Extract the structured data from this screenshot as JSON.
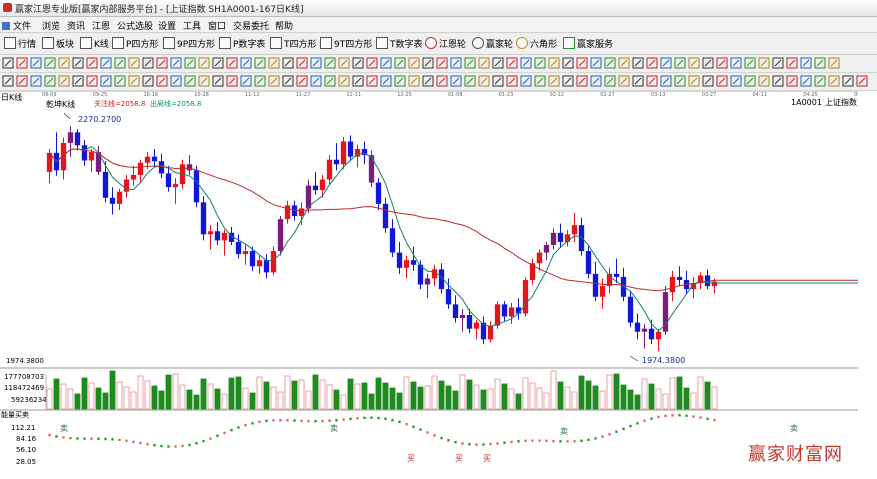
{
  "window": {
    "title": "赢家江恩专业版[赢家内部服务平台] - [上证指数  SH1A0001-167日K线]"
  },
  "menu": [
    "文件",
    "浏览",
    "资讯",
    "江恩",
    "公式选股",
    "设置",
    "工具",
    "窗口",
    "交易委托",
    "帮助"
  ],
  "toolbar": [
    "行情",
    "板块",
    "K线",
    "P四方形",
    "9P四方形",
    "P数字表",
    "T四方形",
    "9T四方形",
    "T数字表",
    "江恩轮",
    "赢家轮",
    "六角形",
    "赢家服务"
  ],
  "chart_header": {
    "period": "日K线",
    "code": "1A0001",
    "name": "上证指数",
    "indicator_name": "乾坤K线",
    "attention_line": "关注线=2058.8",
    "exit_line": "出局线=2058.8",
    "high_label": "2270.2700",
    "low_label": "1974.3800",
    "price_axis_label": "1974.3800"
  },
  "x_dates": [
    "09-09",
    "09-25",
    "10-16",
    "10-28",
    "11-12",
    "11-27",
    "12-11",
    "12-25",
    "01-08",
    "01-23",
    "02-12",
    "02-27",
    "03-13",
    "03-27",
    "04-11",
    "04-25",
    "05-09"
  ],
  "volume_panel": {
    "ticks": [
      "177708703",
      "118472469",
      "59236234"
    ]
  },
  "buysell_panel": {
    "title": "能量买卖",
    "ticks": [
      "112.21",
      "84.16",
      "56.10",
      "28.05"
    ],
    "signals": [
      "卖",
      "卖",
      "卖",
      "卖",
      "买",
      "买",
      "买"
    ]
  },
  "watermark": "赢家财富网",
  "colors": {
    "up": "#e8141b",
    "down": "#1018d8",
    "neutral": "#7a1c7e",
    "ma": "#12806a",
    "ma_long": "#c0282b",
    "vol_up": "#e78a93",
    "vol_down": "#1f8a1f"
  },
  "chart_data": {
    "type": "candlestick",
    "candles": [
      [
        2210,
        2240,
        2195,
        2235
      ],
      [
        2235,
        2262,
        2205,
        2212
      ],
      [
        2212,
        2255,
        2200,
        2248
      ],
      [
        2248,
        2270.27,
        2230,
        2262
      ],
      [
        2262,
        2266,
        2238,
        2245
      ],
      [
        2245,
        2252,
        2218,
        2225
      ],
      [
        2225,
        2240,
        2210,
        2236
      ],
      [
        2236,
        2244,
        2206,
        2210
      ],
      [
        2210,
        2224,
        2170,
        2176
      ],
      [
        2176,
        2190,
        2154,
        2168
      ],
      [
        2168,
        2188,
        2160,
        2184
      ],
      [
        2184,
        2206,
        2176,
        2200
      ],
      [
        2200,
        2218,
        2192,
        2206
      ],
      [
        2206,
        2226,
        2196,
        2222
      ],
      [
        2222,
        2236,
        2214,
        2230
      ],
      [
        2230,
        2240,
        2218,
        2224
      ],
      [
        2224,
        2234,
        2202,
        2208
      ],
      [
        2208,
        2218,
        2184,
        2190
      ],
      [
        2190,
        2202,
        2168,
        2194
      ],
      [
        2194,
        2226,
        2188,
        2220
      ],
      [
        2220,
        2232,
        2206,
        2212
      ],
      [
        2212,
        2218,
        2164,
        2170
      ],
      [
        2170,
        2178,
        2120,
        2128
      ],
      [
        2128,
        2140,
        2108,
        2132
      ],
      [
        2132,
        2144,
        2114,
        2120
      ],
      [
        2120,
        2134,
        2100,
        2130
      ],
      [
        2130,
        2138,
        2114,
        2118
      ],
      [
        2118,
        2128,
        2096,
        2102
      ],
      [
        2102,
        2116,
        2088,
        2106
      ],
      [
        2106,
        2112,
        2080,
        2086
      ],
      [
        2086,
        2100,
        2076,
        2094
      ],
      [
        2094,
        2102,
        2070,
        2078
      ],
      [
        2078,
        2112,
        2074,
        2106
      ],
      [
        2106,
        2152,
        2100,
        2148
      ],
      [
        2148,
        2172,
        2142,
        2166
      ],
      [
        2166,
        2172,
        2146,
        2152
      ],
      [
        2152,
        2170,
        2140,
        2162
      ],
      [
        2162,
        2200,
        2156,
        2192
      ],
      [
        2192,
        2210,
        2180,
        2186
      ],
      [
        2186,
        2206,
        2176,
        2200
      ],
      [
        2200,
        2232,
        2194,
        2226
      ],
      [
        2226,
        2248,
        2212,
        2220
      ],
      [
        2220,
        2256,
        2214,
        2250
      ],
      [
        2250,
        2258,
        2224,
        2230
      ],
      [
        2230,
        2246,
        2216,
        2240
      ],
      [
        2240,
        2250,
        2220,
        2232
      ],
      [
        2232,
        2238,
        2190,
        2196
      ],
      [
        2196,
        2202,
        2160,
        2168
      ],
      [
        2168,
        2176,
        2130,
        2136
      ],
      [
        2136,
        2148,
        2098,
        2104
      ],
      [
        2104,
        2118,
        2076,
        2084
      ],
      [
        2084,
        2100,
        2070,
        2094
      ],
      [
        2094,
        2112,
        2080,
        2088
      ],
      [
        2088,
        2094,
        2056,
        2062
      ],
      [
        2062,
        2076,
        2044,
        2070
      ],
      [
        2070,
        2088,
        2060,
        2082
      ],
      [
        2082,
        2090,
        2050,
        2056
      ],
      [
        2056,
        2070,
        2030,
        2036
      ],
      [
        2036,
        2048,
        2012,
        2018
      ],
      [
        2018,
        2030,
        2000,
        2022
      ],
      [
        2022,
        2030,
        1998,
        2004
      ],
      [
        2004,
        2016,
        1990,
        2012
      ],
      [
        2012,
        2020,
        1984,
        1990
      ],
      [
        1990,
        2014,
        1986,
        2008
      ],
      [
        2008,
        2040,
        2004,
        2036
      ],
      [
        2036,
        2040,
        2014,
        2020
      ],
      [
        2020,
        2038,
        2010,
        2032
      ],
      [
        2032,
        2044,
        2016,
        2024
      ],
      [
        2024,
        2072,
        2020,
        2068
      ],
      [
        2068,
        2096,
        2062,
        2090
      ],
      [
        2090,
        2108,
        2080,
        2104
      ],
      [
        2104,
        2118,
        2094,
        2114
      ],
      [
        2114,
        2136,
        2108,
        2130
      ],
      [
        2130,
        2142,
        2110,
        2118
      ],
      [
        2118,
        2134,
        2112,
        2128
      ],
      [
        2128,
        2156,
        2118,
        2140
      ],
      [
        2140,
        2150,
        2100,
        2106
      ],
      [
        2106,
        2112,
        2070,
        2076
      ],
      [
        2076,
        2092,
        2040,
        2046
      ],
      [
        2046,
        2070,
        2030,
        2060
      ],
      [
        2060,
        2084,
        2050,
        2076
      ],
      [
        2076,
        2096,
        2064,
        2072
      ],
      [
        2072,
        2084,
        2040,
        2046
      ],
      [
        2046,
        2054,
        2006,
        2012
      ],
      [
        2012,
        2024,
        1990,
        2000
      ],
      [
        2000,
        2010,
        1978,
        2004
      ],
      [
        2004,
        2016,
        1984,
        1990
      ],
      [
        1990,
        2004,
        1974.38,
        2000
      ],
      [
        2000,
        2060,
        1996,
        2052
      ],
      [
        2052,
        2080,
        2040,
        2072
      ],
      [
        2072,
        2086,
        2060,
        2068
      ],
      [
        2068,
        2080,
        2050,
        2056
      ],
      [
        2056,
        2072,
        2044,
        2064
      ],
      [
        2064,
        2078,
        2056,
        2074
      ],
      [
        2074,
        2082,
        2056,
        2060
      ],
      [
        2060,
        2070,
        2050,
        2066
      ]
    ]
  }
}
